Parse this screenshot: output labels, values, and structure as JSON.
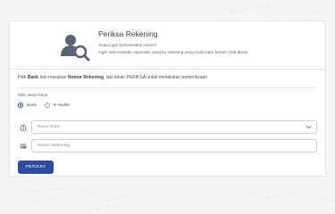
{
  "header": {
    "title": "Periksa Rekening",
    "desc_line1": "Anda ingin bertransaksi online?",
    "desc_line2": "Ingin men-transfer sejumlah uang ke rekening yang Anda baru kenal? Cek disini!"
  },
  "instruction": {
    "part1": "Pilih ",
    "bold1": "Bank",
    "part2": " dan masukan ",
    "bold2": "Nomor Rekening",
    "part3": ", lalu tekan PERIKSA untuk melakukan pemeriksaan"
  },
  "account_type": {
    "label": "Pilih Jenis Akun",
    "options": [
      "Bank",
      "E-Wallet"
    ],
    "selected": "Bank"
  },
  "bank_select": {
    "placeholder": "Nama Bank"
  },
  "account_input": {
    "placeholder": "Nomor Rekening"
  },
  "submit": {
    "label": "PERIKSA"
  },
  "icons": {
    "hero": "user-search-icon",
    "bank": "bank-icon",
    "card": "card-icon",
    "chevron": "chevron-down-icon"
  },
  "colors": {
    "primary": "#2e4b9d",
    "icon": "#5b6270"
  }
}
